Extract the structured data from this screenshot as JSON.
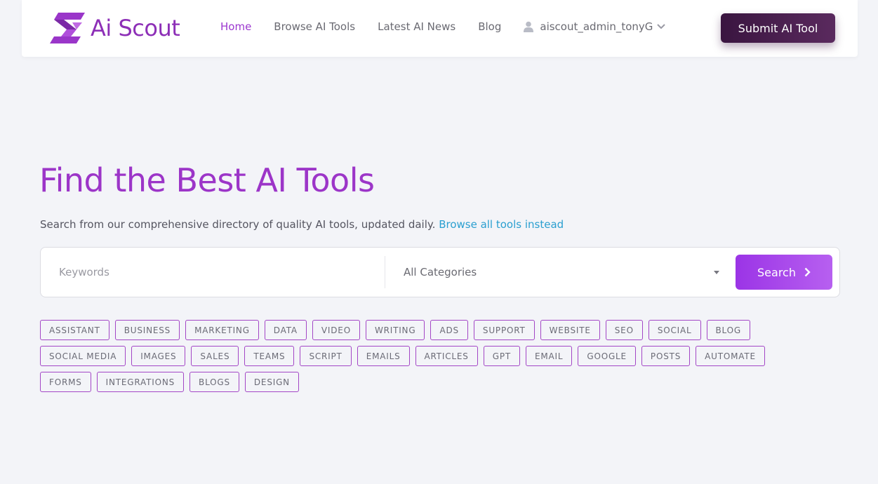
{
  "brand": {
    "name": "Ai Scout",
    "color": "#8d2fb7"
  },
  "nav": {
    "items": [
      {
        "label": "Home",
        "active": true
      },
      {
        "label": "Browse AI Tools",
        "active": false
      },
      {
        "label": "Latest AI News",
        "active": false
      },
      {
        "label": "Blog",
        "active": false
      }
    ],
    "user": {
      "name": "aiscout_admin_tonyG",
      "icon": "user-icon"
    },
    "submit_label": "Submit AI Tool"
  },
  "hero": {
    "title": "Find the Best AI Tools",
    "subtitle": "Search from our comprehensive directory of quality AI tools, updated daily.",
    "browse_link": "Browse all tools instead"
  },
  "search": {
    "keywords_placeholder": "Keywords",
    "keywords_value": "",
    "category_selected": "All Categories",
    "button_label": "Search"
  },
  "tags": [
    "ASSISTANT",
    "BUSINESS",
    "MARKETING",
    "DATA",
    "VIDEO",
    "WRITING",
    "ADS",
    "SUPPORT",
    "WEBSITE",
    "SEO",
    "SOCIAL",
    "BLOG",
    "SOCIAL MEDIA",
    "IMAGES",
    "SALES",
    "TEAMS",
    "SCRIPT",
    "EMAILS",
    "ARTICLES",
    "GPT",
    "EMAIL",
    "GOOGLE",
    "POSTS",
    "AUTOMATE",
    "FORMS",
    "INTEGRATIONS",
    "BLOGS",
    "DESIGN"
  ],
  "colors": {
    "accent": "#9c35c8",
    "link": "#2a9fd0",
    "button_dark": "#3a1540"
  }
}
